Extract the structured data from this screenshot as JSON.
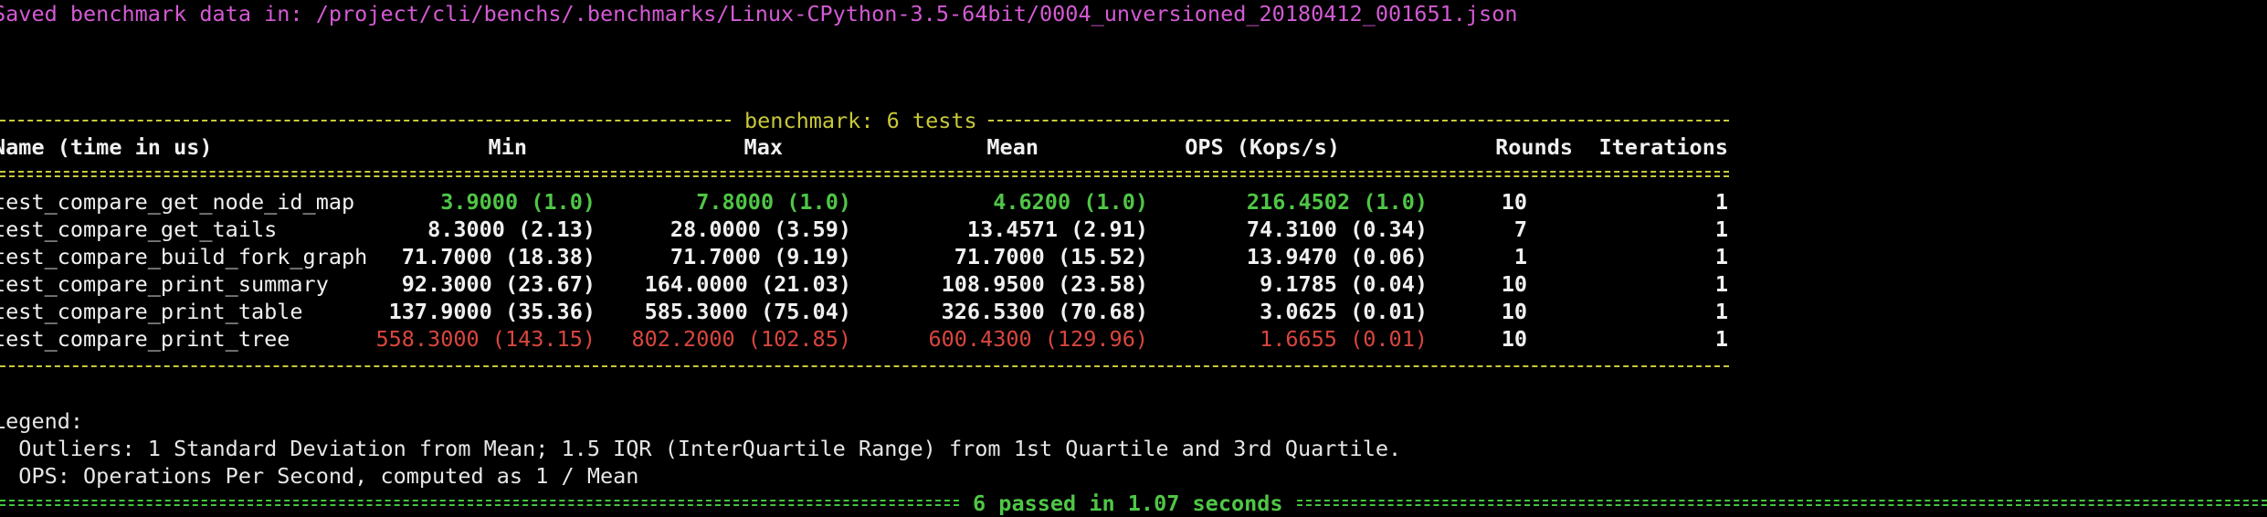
{
  "saved_message": "Saved benchmark data in: /project/cli/benchs/.benchmarks/Linux-CPython-3.5-64bit/0004_unversioned_20180412_001651.json",
  "banner": "benchmark: 6 tests",
  "headers": {
    "name": "Name (time in us)",
    "min": "Min",
    "max": "Max",
    "mean": "Mean",
    "ops": "OPS (Kops/s)",
    "rounds": "Rounds",
    "iterations": "Iterations"
  },
  "rows": [
    {
      "name": "test_compare_get_node_id_map",
      "min": "3.9000 (1.0)",
      "max": "7.8000 (1.0)",
      "mean": "4.6200 (1.0)",
      "ops": "216.4502 (1.0)",
      "rounds": "10",
      "iterations": "1",
      "style": "green"
    },
    {
      "name": "test_compare_get_tails",
      "min": "8.3000 (2.13)",
      "max": "28.0000 (3.59)",
      "mean": "13.4571 (2.91)",
      "ops": "74.3100 (0.34)",
      "rounds": "7",
      "iterations": "1",
      "style": "white"
    },
    {
      "name": "test_compare_build_fork_graph",
      "min": "71.7000 (18.38)",
      "max": "71.7000 (9.19)",
      "mean": "71.7000 (15.52)",
      "ops": "13.9470 (0.06)",
      "rounds": "1",
      "iterations": "1",
      "style": "white"
    },
    {
      "name": "test_compare_print_summary",
      "min": "92.3000 (23.67)",
      "max": "164.0000 (21.03)",
      "mean": "108.9500 (23.58)",
      "ops": "9.1785 (0.04)",
      "rounds": "10",
      "iterations": "1",
      "style": "white"
    },
    {
      "name": "test_compare_print_table",
      "min": "137.9000 (35.36)",
      "max": "585.3000 (75.04)",
      "mean": "326.5300 (70.68)",
      "ops": "3.0625 (0.01)",
      "rounds": "10",
      "iterations": "1",
      "style": "white"
    },
    {
      "name": "test_compare_print_tree",
      "min": "558.3000 (143.15)",
      "max": "802.2000 (102.85)",
      "mean": "600.4300 (129.96)",
      "ops": "1.6655 (0.01)",
      "rounds": "10",
      "iterations": "1",
      "style": "red"
    }
  ],
  "legend": {
    "title": "Legend:",
    "outliers": "  Outliers: 1 Standard Deviation from Mean; 1.5 IQR (InterQuartile Range) from 1st Quartile and 3rd Quartile.",
    "ops": "  OPS: Operations Per Second, computed as 1 / Mean"
  },
  "summary": "6 passed in 1.07 seconds",
  "colors": {
    "background": "#000000",
    "magenta": "#d45ad4",
    "yellow": "#c8c83a",
    "green": "#4fc646",
    "red": "#d9463f",
    "text": "#f0f0f0"
  }
}
